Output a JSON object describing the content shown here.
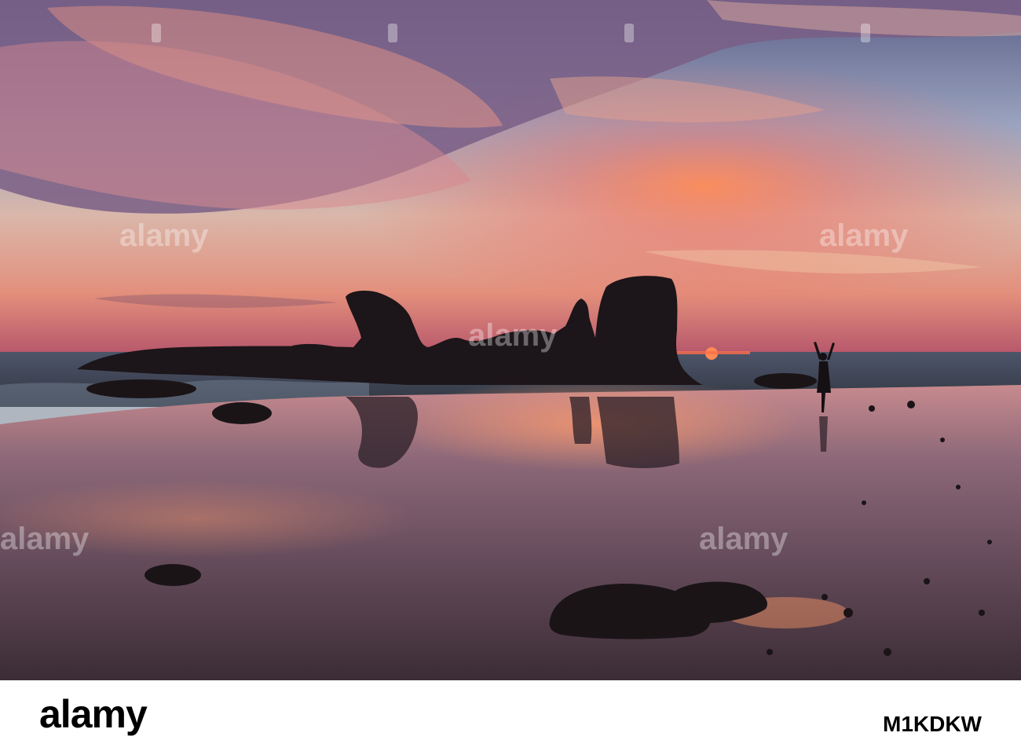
{
  "photo": {
    "watermark_text": "alamy",
    "subject_icons": [
      "sea-stack-rock-icon",
      "setting-sun-icon",
      "person-silhouette-icon",
      "beach-boulder-icon"
    ],
    "colors": {
      "sky_top": "#6b6f8e",
      "sky_mid": "#e5b9a4",
      "horizon_glow": "#f07050",
      "sun": "#ff7a4a",
      "sea": "#3d4452",
      "wet_sand": "#5c4a55",
      "silhouette": "#1b1518"
    }
  },
  "footer": {
    "logo_text": "alamy",
    "image_id": "M1KDKW"
  }
}
